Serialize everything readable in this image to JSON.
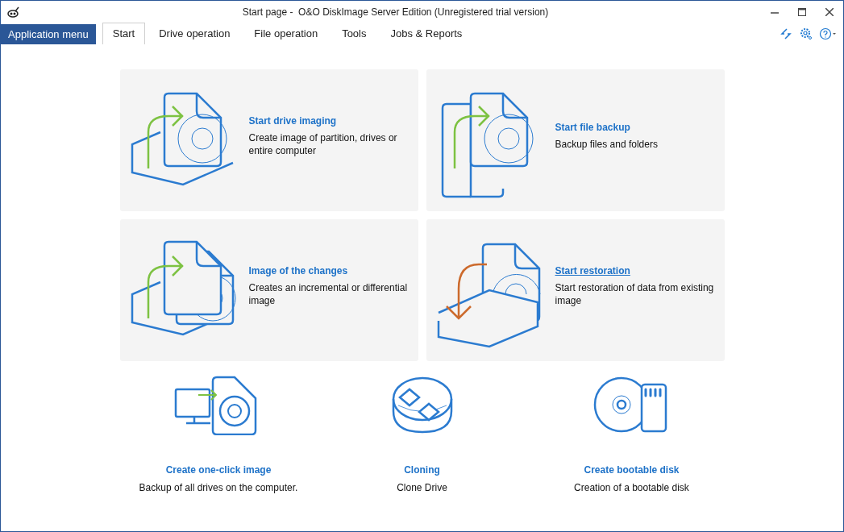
{
  "window": {
    "title": "Start page -  O&O DiskImage Server Edition (Unregistered trial version)"
  },
  "app_menu": {
    "label": "Application menu"
  },
  "tabs": [
    {
      "label": "Start",
      "selected": true
    },
    {
      "label": "Drive operation",
      "selected": false
    },
    {
      "label": "File operation",
      "selected": false
    },
    {
      "label": "Tools",
      "selected": false
    },
    {
      "label": "Jobs & Reports",
      "selected": false
    }
  ],
  "tiles": [
    {
      "kind": "drive-imaging",
      "title": "Start drive imaging",
      "description": "Create image of partition, drives or entire computer",
      "hovered": false
    },
    {
      "kind": "file-backup",
      "title": "Start file backup",
      "description": "Backup files and folders",
      "hovered": false
    },
    {
      "kind": "changes",
      "title": "Image of the changes",
      "description": "Creates an incremental or differential image",
      "hovered": false
    },
    {
      "kind": "restore",
      "title": "Start restoration",
      "description": "Start restoration of data from existing image",
      "hovered": true
    }
  ],
  "actions": [
    {
      "kind": "one-click",
      "title": "Create one-click image",
      "description": "Backup of all drives on the computer."
    },
    {
      "kind": "cloning",
      "title": "Cloning",
      "description": "Clone Drive"
    },
    {
      "kind": "bootable",
      "title": "Create bootable disk",
      "description": "Creation of a bootable disk"
    }
  ]
}
